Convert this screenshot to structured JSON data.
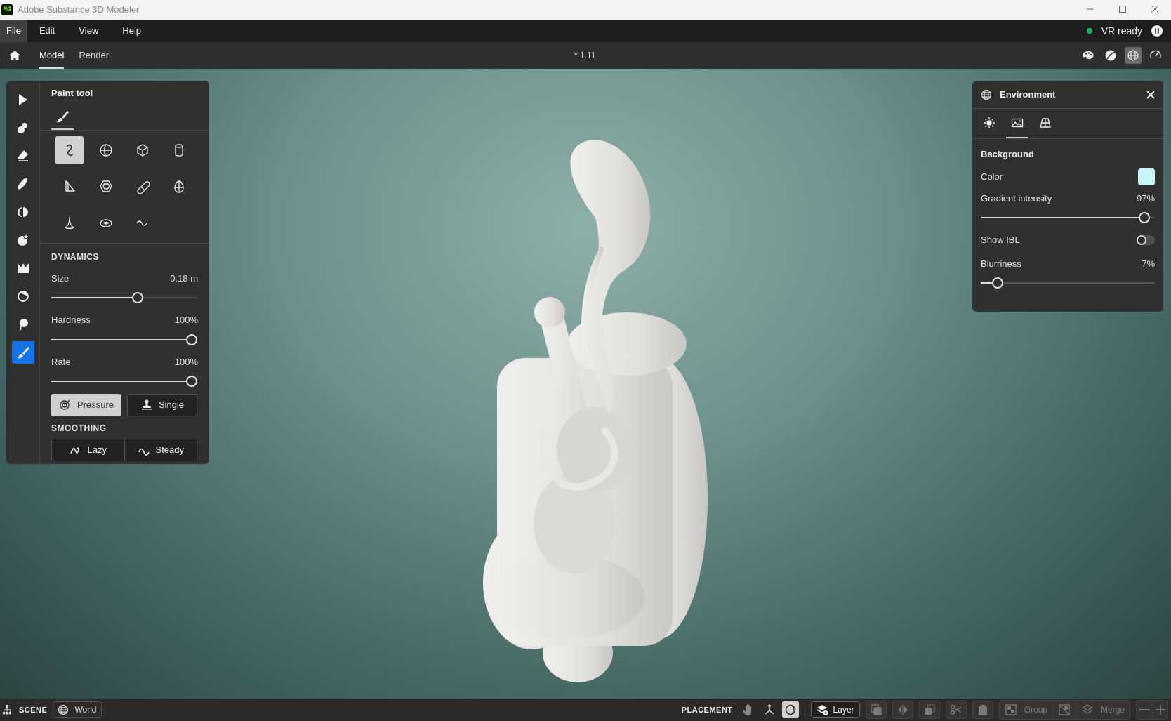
{
  "window": {
    "title": "Adobe Substance 3D Modeler",
    "logo": "Md"
  },
  "menu": [
    {
      "label": "File",
      "selected": true
    },
    {
      "label": "Edit",
      "selected": false
    },
    {
      "label": "View",
      "selected": false
    },
    {
      "label": "Help",
      "selected": false
    }
  ],
  "status": {
    "label": "VR ready",
    "color": "#1db36b"
  },
  "mode_tabs": [
    {
      "label": "Model",
      "selected": true
    },
    {
      "label": "Render",
      "selected": false
    }
  ],
  "document_title": "* 1.11",
  "view_toggles": [
    {
      "selected": false
    },
    {
      "selected": false
    },
    {
      "selected": true
    },
    {
      "selected": false
    }
  ],
  "tools": [
    {
      "selected": false
    },
    {
      "selected": false
    },
    {
      "selected": false
    },
    {
      "selected": false
    },
    {
      "selected": false
    },
    {
      "selected": false
    },
    {
      "selected": false
    },
    {
      "selected": false
    },
    {
      "selected": false
    },
    {
      "selected": true
    }
  ],
  "paint_panel": {
    "title": "Paint tool",
    "tabs": [
      {
        "selected": true
      }
    ],
    "shapes": [
      {
        "selected": true
      },
      {
        "selected": false
      },
      {
        "selected": false
      },
      {
        "selected": false
      },
      {
        "selected": false
      },
      {
        "selected": false
      },
      {
        "selected": false
      },
      {
        "selected": false
      },
      {
        "selected": false
      },
      {
        "selected": false
      },
      {
        "selected": false
      }
    ],
    "dynamics_heading": "DYNAMICS",
    "sliders": [
      {
        "label": "Size",
        "reading": "0.18 m",
        "level": 0.6
      },
      {
        "label": "Hardness",
        "reading": "100%",
        "level": 1
      },
      {
        "label": "Rate",
        "reading": "100%",
        "level": 1
      }
    ],
    "modes": [
      {
        "label": "Pressure",
        "selected": true
      },
      {
        "label": "Single",
        "selected": false
      }
    ],
    "smoothing_heading": "SMOOTHING",
    "smoothing": [
      {
        "label": "Lazy",
        "selected": false
      },
      {
        "label": "Steady",
        "selected": false
      }
    ]
  },
  "environment_panel": {
    "title": "Environment",
    "tabs": [
      {
        "selected": false
      },
      {
        "selected": true
      },
      {
        "selected": false
      }
    ],
    "section": "Background",
    "color": {
      "label": "Color",
      "color": "#c8f6f6"
    },
    "gradient": {
      "label": "Gradient intensity",
      "reading": "97%",
      "level": 0.97
    },
    "ibl": {
      "label": "Show IBL",
      "on": false
    },
    "blurriness": {
      "label": "Blurriness",
      "reading": "7%",
      "level": 0.07
    }
  },
  "bottom_bar": {
    "scene_label": "SCENE",
    "space_button": "World",
    "placement_label": "PLACEMENT",
    "placement_tools": [
      {
        "selected": false
      },
      {
        "selected": false
      },
      {
        "selected": true
      }
    ],
    "layer_button": "Layer",
    "edit_tools": [
      {
        "disabled": true
      },
      {
        "disabled": true
      },
      {
        "disabled": true
      },
      {
        "disabled": true
      },
      {
        "disabled": true
      }
    ],
    "group_actions": [
      {
        "label": "Group",
        "disabled": true
      },
      {
        "disabled": true
      },
      {
        "label": "Merge",
        "disabled": true
      }
    ],
    "zoom_tools": [
      {
        "disabled": true
      },
      {
        "disabled": true
      }
    ]
  }
}
